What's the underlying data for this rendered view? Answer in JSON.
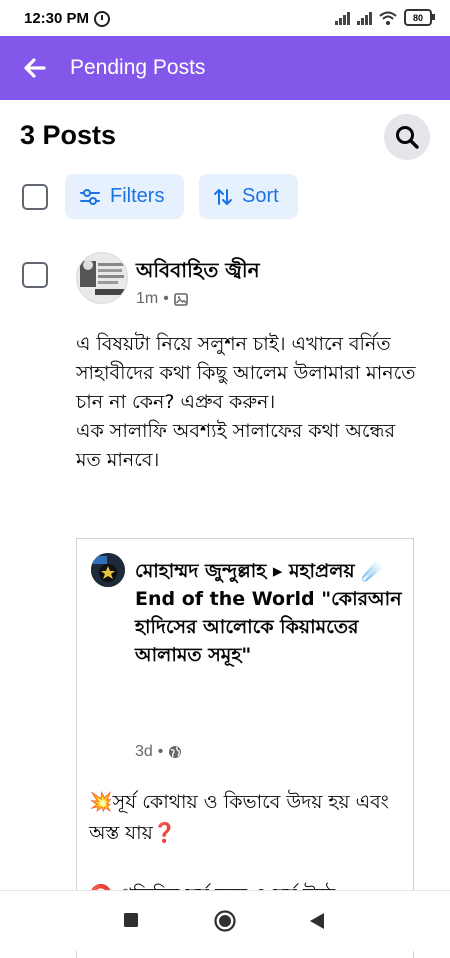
{
  "status": {
    "time": "12:30 PM",
    "battery": "80"
  },
  "appbar": {
    "title": "Pending Posts"
  },
  "header": {
    "count_label": "3 Posts"
  },
  "toolbar": {
    "filters_label": "Filters",
    "sort_label": "Sort"
  },
  "post": {
    "author": "অবিবাহিত জ্বীন",
    "time": "1m",
    "text_lines": [
      "এ বিষয়টা নিয়ে সলুশন চাই। এখানে বর্নিত সাহাবীদের কথা কিছু আলেম উলামারা মানতে চান না কেন? এপ্রুব করুন।",
      "এক সালাফি অবশ্যই সালাফের কথা অন্ধের মত মানবে।"
    ]
  },
  "shared": {
    "author": "মোহাম্মদ জুন্দুল্লাহ ▸ মহাপ্রলয় ☄️ End of the World \"কোরআন হাদিসের আলোকে কিয়ামতের আলামত সমূহ\"",
    "time": "3d",
    "text": "💥সূর্য কোথায় ও কিভাবে উদয় হয় এবং অস্ত যায়❓",
    "more": "⭕ প্রতিদিন সূর্য ডুবে ও সূর্য উঠে"
  },
  "icons": {
    "back": "arrow-left-icon",
    "search": "search-icon",
    "filters": "filter-sliders-icon",
    "sort": "sort-arrows-icon",
    "photo": "photo-icon",
    "globe": "globe-icon"
  },
  "colors": {
    "accent": "#8357e9",
    "link": "#1b74e4",
    "pill_bg": "#e7f1fd"
  }
}
